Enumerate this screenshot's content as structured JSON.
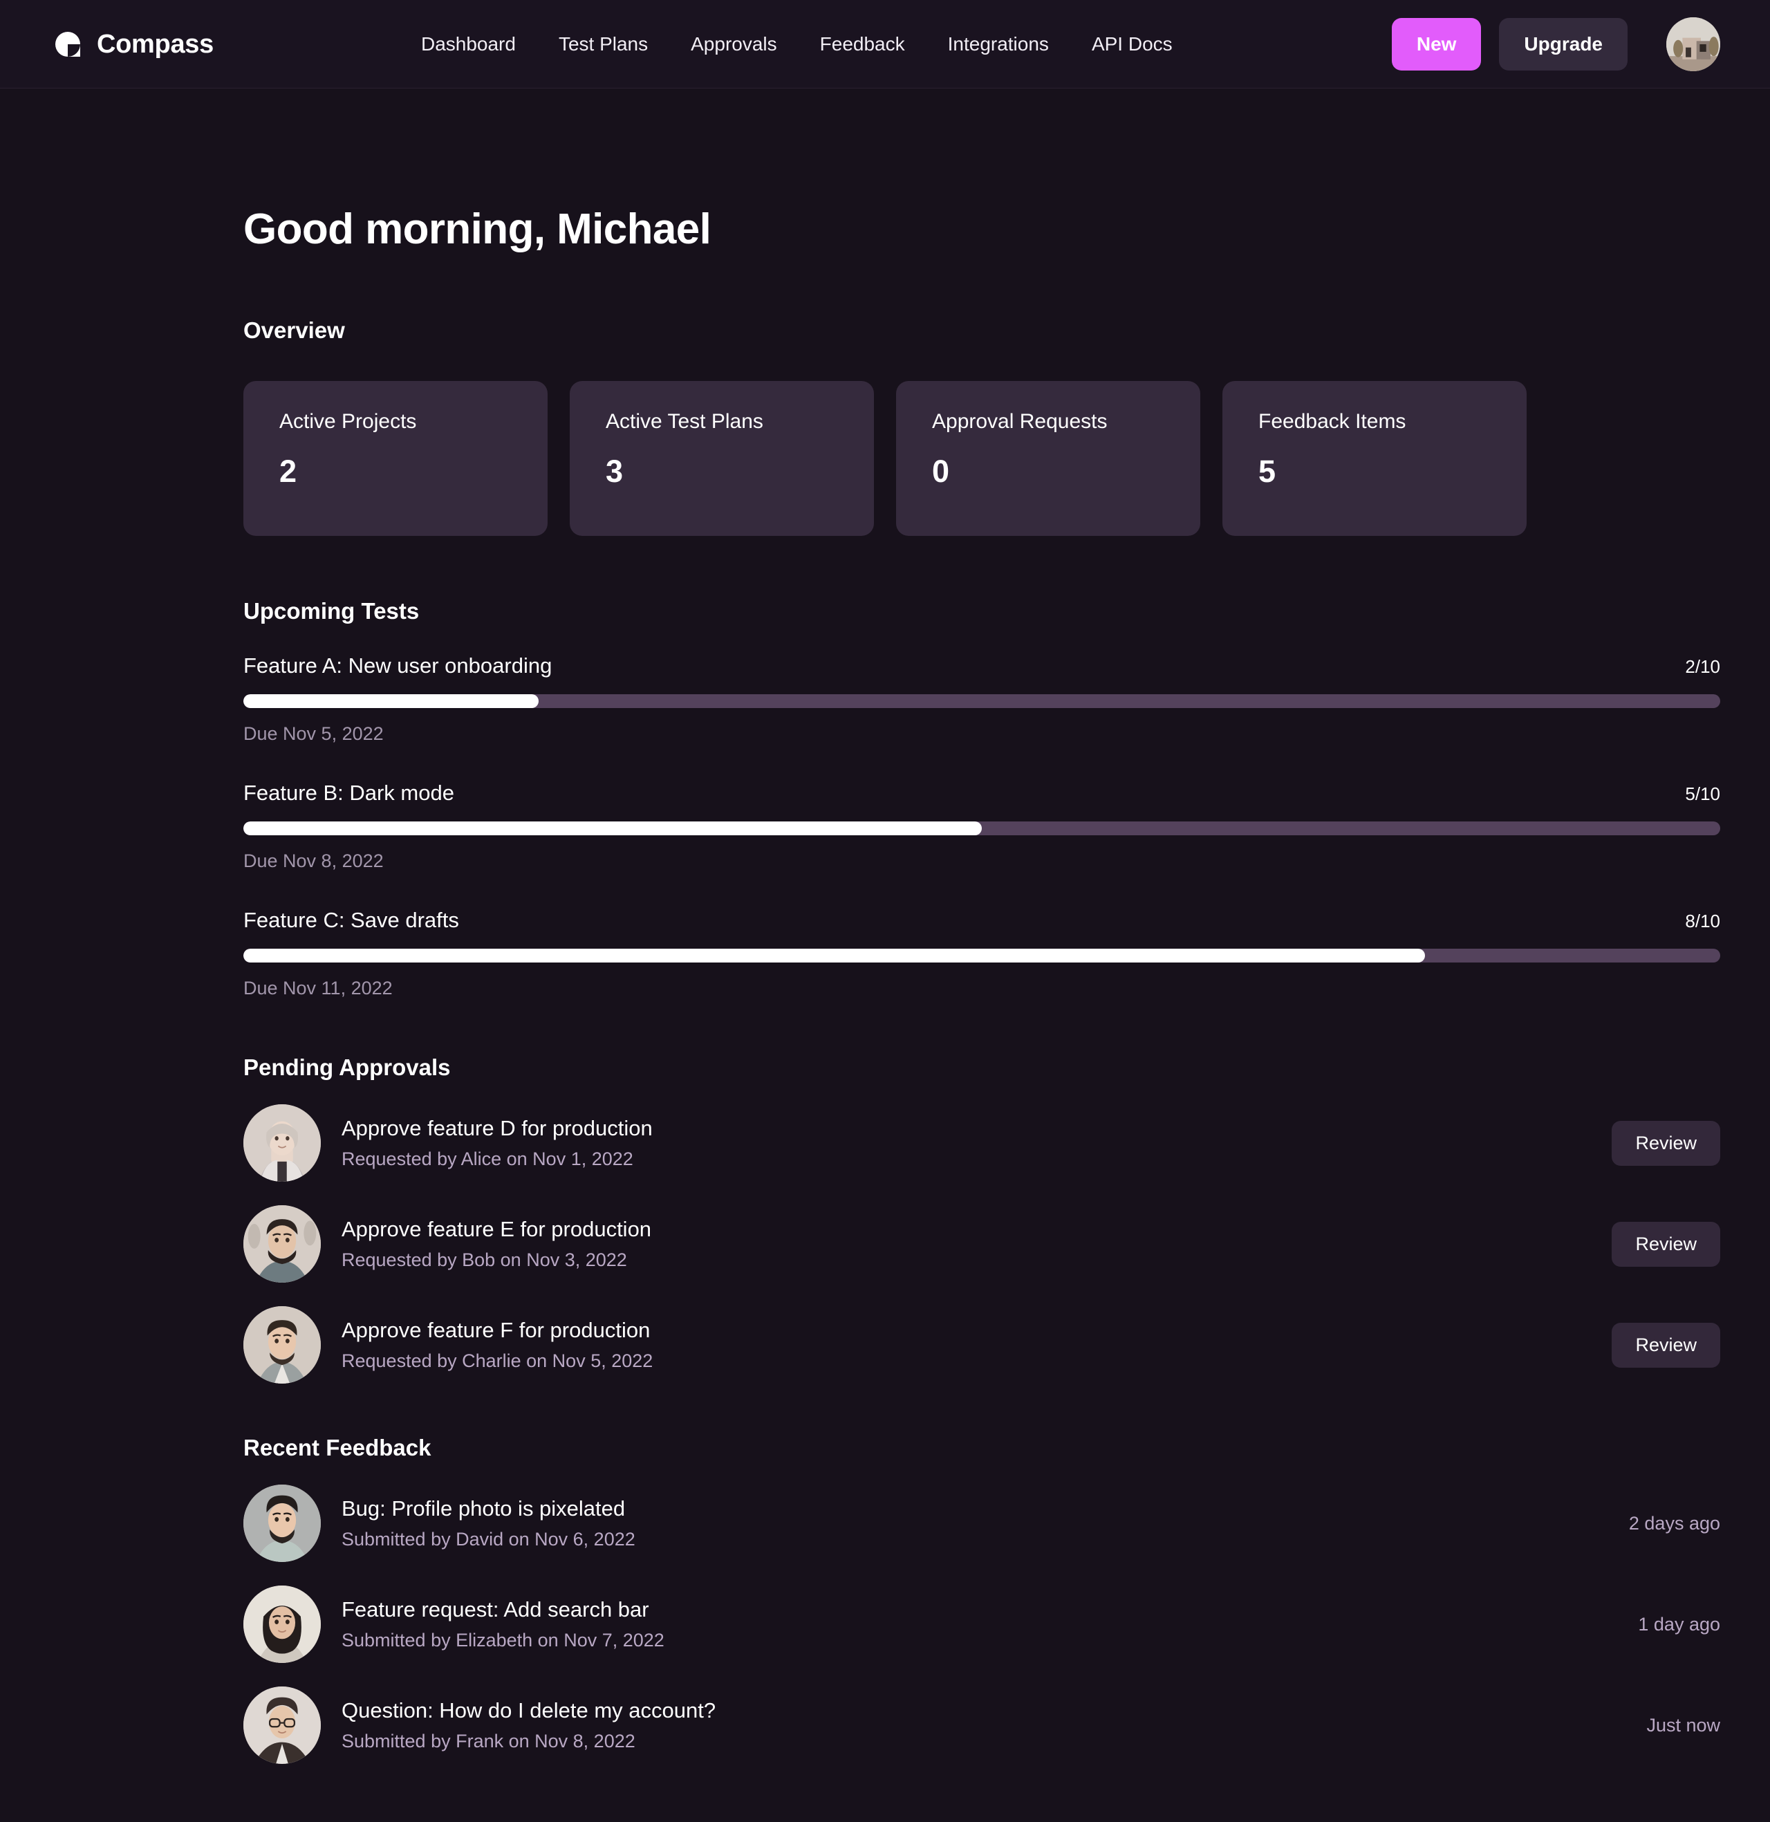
{
  "brand": {
    "name": "Compass",
    "logo_icon": "compass-pac-logo"
  },
  "nav": {
    "links": [
      {
        "label": "Dashboard"
      },
      {
        "label": "Test Plans"
      },
      {
        "label": "Approvals"
      },
      {
        "label": "Feedback"
      },
      {
        "label": "Integrations"
      },
      {
        "label": "API Docs"
      }
    ],
    "new_label": "New",
    "upgrade_label": "Upgrade",
    "avatar_alt": "user-avatar"
  },
  "colors": {
    "page_bg": "#17111b",
    "topbar_bg": "#1a1320",
    "accent": "#e25cfb",
    "card_bg": "#352a3d",
    "track": "#54425c",
    "fill": "#ffffff",
    "muted_text": "#b9a8c4",
    "due_text": "#a296ab",
    "button_dark": "#33283a"
  },
  "greeting": "Good morning, Michael",
  "overview": {
    "title": "Overview",
    "cards": [
      {
        "label": "Active Projects",
        "value": "2"
      },
      {
        "label": "Active Test Plans",
        "value": "3"
      },
      {
        "label": "Approval Requests",
        "value": "0"
      },
      {
        "label": "Feedback Items",
        "value": "5"
      }
    ]
  },
  "upcoming_tests": {
    "title": "Upcoming Tests",
    "items": [
      {
        "name": "Feature A: New user onboarding",
        "count": "2/10",
        "percent": 20,
        "due": "Due Nov 5, 2022"
      },
      {
        "name": "Feature B: Dark mode",
        "count": "5/10",
        "percent": 50,
        "due": "Due Nov 8, 2022"
      },
      {
        "name": "Feature C: Save drafts",
        "count": "8/10",
        "percent": 80,
        "due": "Due Nov 11, 2022"
      }
    ]
  },
  "pending_approvals": {
    "title": "Pending Approvals",
    "action_label": "Review",
    "items": [
      {
        "title": "Approve feature D for production",
        "sub": "Requested by Alice on Nov 1, 2022",
        "action": "Review",
        "avatar": "alice-avatar"
      },
      {
        "title": "Approve feature E for production",
        "sub": "Requested by Bob on Nov 3, 2022",
        "action": "Review",
        "avatar": "bob-avatar"
      },
      {
        "title": "Approve feature F for production",
        "sub": "Requested by Charlie on Nov 5, 2022",
        "action": "Review",
        "avatar": "charlie-avatar"
      }
    ]
  },
  "recent_feedback": {
    "title": "Recent Feedback",
    "items": [
      {
        "title": "Bug: Profile photo is pixelated",
        "sub": "Submitted by David on Nov 6, 2022",
        "time": "2 days ago",
        "avatar": "david-avatar"
      },
      {
        "title": "Feature request: Add search bar",
        "sub": "Submitted by Elizabeth on Nov 7, 2022",
        "time": "1 day ago",
        "avatar": "elizabeth-avatar"
      },
      {
        "title": "Question: How do I delete my account?",
        "sub": "Submitted by Frank on Nov 8, 2022",
        "time": "Just now",
        "avatar": "frank-avatar"
      }
    ]
  }
}
